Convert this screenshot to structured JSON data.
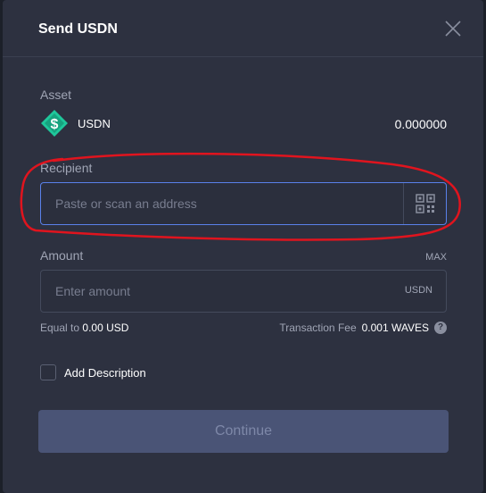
{
  "modal": {
    "title": "Send USDN"
  },
  "asset": {
    "label": "Asset",
    "name": "USDN",
    "balance": "0.000000",
    "icon_color": "#1fc79b"
  },
  "recipient": {
    "label": "Recipient",
    "placeholder": "Paste or scan an address",
    "value": ""
  },
  "amount": {
    "label": "Amount",
    "max_label": "MAX",
    "placeholder": "Enter amount",
    "value": "",
    "unit": "USDN"
  },
  "summary": {
    "equal_to_prefix": "Equal to",
    "equal_to_value": "0.00 USD",
    "fee_prefix": "Transaction Fee",
    "fee_value": "0.001 WAVES"
  },
  "description": {
    "label": "Add Description",
    "checked": false
  },
  "continue_button": {
    "label": "Continue"
  },
  "colors": {
    "accent": "#5a81ea",
    "annotation": "#e0141e"
  }
}
